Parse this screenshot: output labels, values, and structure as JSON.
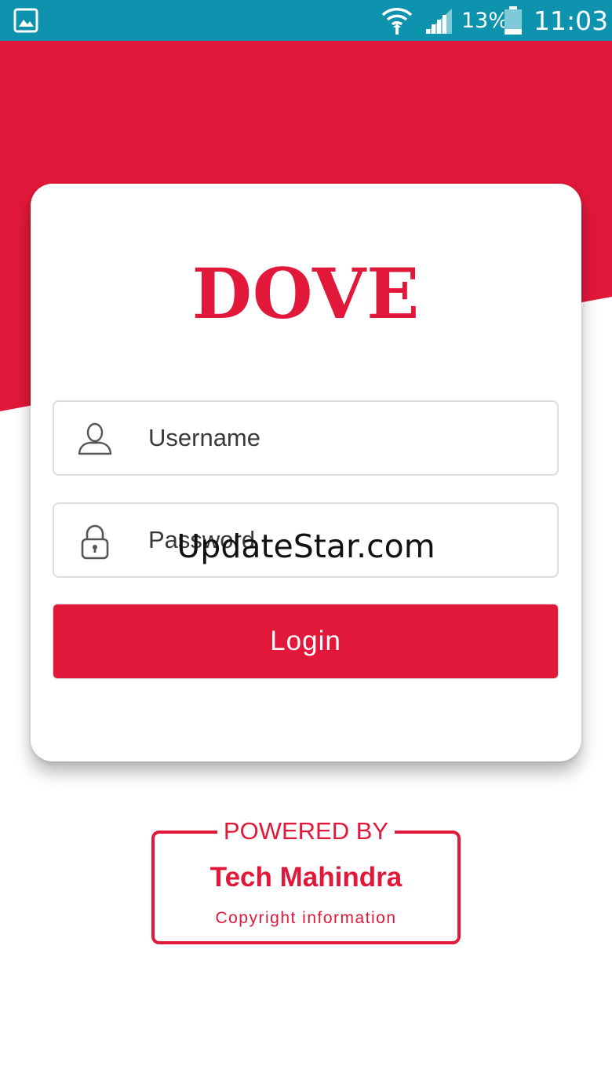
{
  "status_bar": {
    "battery_percent": "13%",
    "time": "11:03",
    "icons": [
      "gallery-icon",
      "wifi-icon",
      "signal-icon",
      "battery-icon"
    ]
  },
  "app": {
    "logo_text": "DOVE",
    "brand_color": "#e2183a"
  },
  "login_form": {
    "username": {
      "placeholder": "Username",
      "value": "",
      "icon": "user-icon"
    },
    "password": {
      "placeholder": "Password",
      "value": "",
      "icon": "lock-icon"
    },
    "login_label": "Login"
  },
  "watermark": "UpdateStar.com",
  "footer": {
    "powered_by": "POWERED BY",
    "company": "Tech Mahindra",
    "copyright": "Copyright information"
  }
}
